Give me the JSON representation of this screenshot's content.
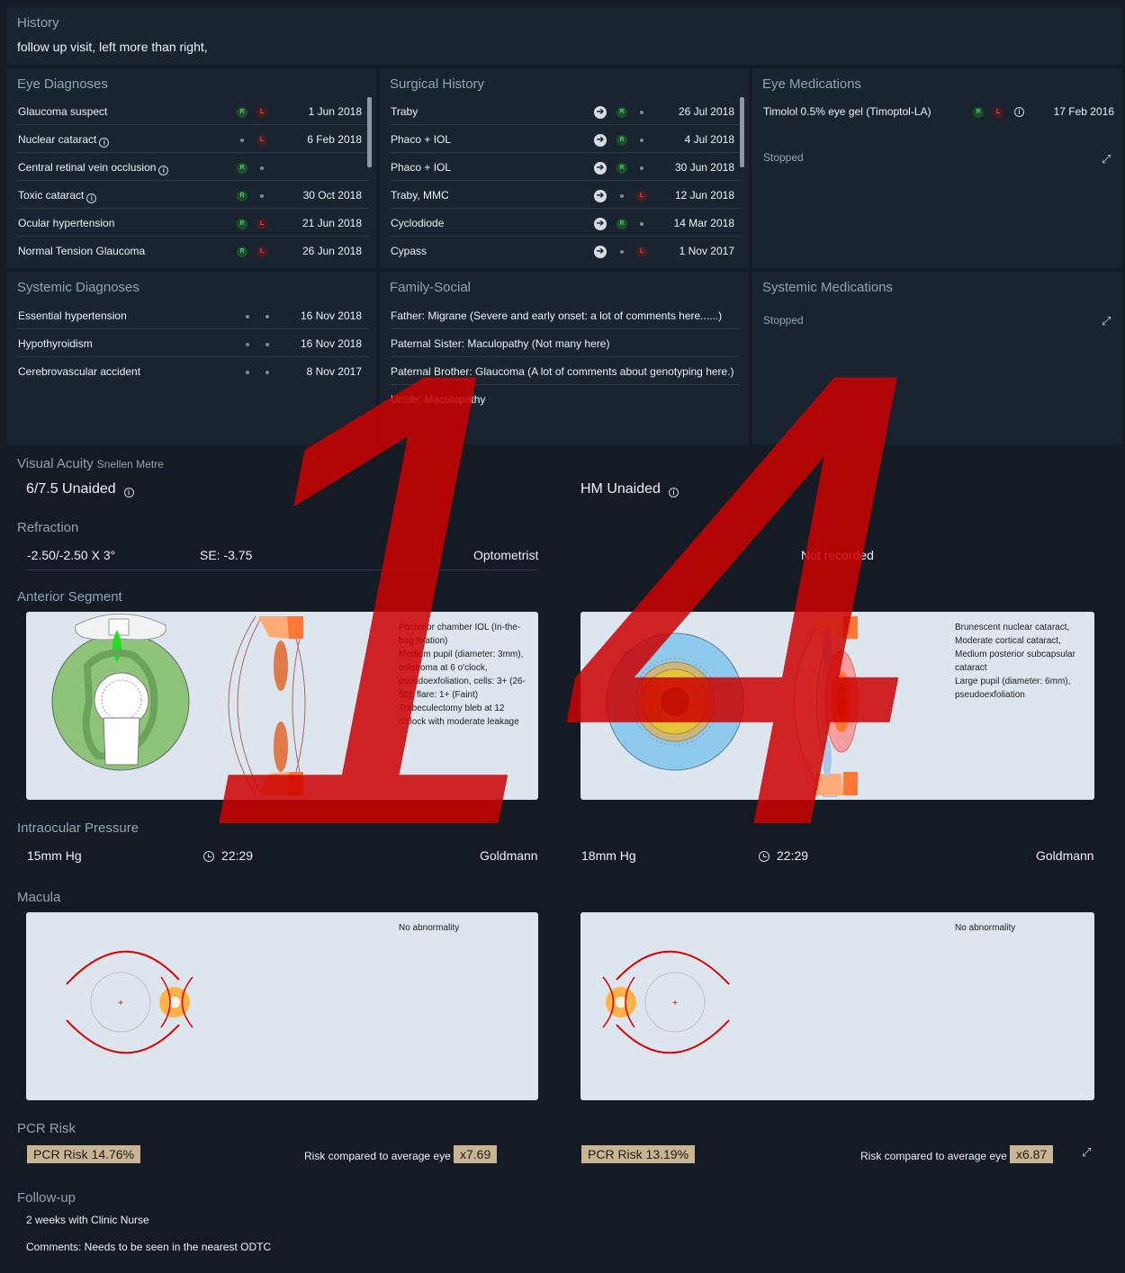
{
  "history": {
    "title": "History",
    "text": "follow up visit, left more than right,"
  },
  "eye_diagnoses": {
    "title": "Eye Diagnoses",
    "rows": [
      {
        "label": "Glaucoma suspect",
        "date": "1 Jun 2018"
      },
      {
        "label": "Nuclear cataract",
        "date": "6 Feb 2018"
      },
      {
        "label": "Central retinal vein occlusion",
        "date": ""
      },
      {
        "label": "Toxic cataract",
        "date": "30 Oct 2018"
      },
      {
        "label": "Ocular hypertension",
        "date": "21 Jun 2018"
      },
      {
        "label": "Normal Tension Glaucoma",
        "date": "26 Jun 2018"
      }
    ]
  },
  "surgical_history": {
    "title": "Surgical History",
    "rows": [
      {
        "label": "Traby",
        "date": "26 Jul 2018"
      },
      {
        "label": "Phaco + IOL",
        "date": "4 Jul 2018"
      },
      {
        "label": "Phaco + IOL",
        "date": "30 Jun 2018"
      },
      {
        "label": "Traby, MMC",
        "date": "12 Jun 2018"
      },
      {
        "label": "Cyclodiode",
        "date": "14 Mar 2018"
      },
      {
        "label": "Cypass",
        "date": "1 Nov 2017"
      }
    ]
  },
  "eye_medications": {
    "title": "Eye Medications",
    "rows": [
      {
        "label": "Timolol 0.5% eye gel (Timoptol-LA)",
        "date": "17 Feb 2016"
      }
    ],
    "stopped": "Stopped"
  },
  "systemic_diagnoses": {
    "title": "Systemic Diagnoses",
    "rows": [
      {
        "label": "Essential hypertension",
        "date": "16 Nov 2018"
      },
      {
        "label": "Hypothyroidism",
        "date": "16 Nov 2018"
      },
      {
        "label": "Cerebrovascular accident",
        "date": "8 Nov 2017"
      }
    ]
  },
  "family_social": {
    "title": "Family-Social",
    "rows": [
      "Father: Migrane (Severe and early onset: a lot of comments here......)",
      "Paternal Sister: Maculopathy (Not many here)",
      "Paternal Brother: Glaucoma (A lot of comments about genotyping here.)",
      "Uncle: Maculopathy"
    ]
  },
  "systemic_medications": {
    "title": "Systemic Medications",
    "stopped": "Stopped"
  },
  "badges": {
    "r": "R",
    "l": "L"
  },
  "icons": {
    "info": "info-icon",
    "arrow": "arrow-right-icon",
    "expand": "expand-icon",
    "clock": "clock-icon"
  },
  "visual_acuity": {
    "title": "Visual Acuity",
    "subtitle": "Snellen Metre",
    "right": "6/7.5 Unaided",
    "left": "HM Unaided"
  },
  "refraction": {
    "title": "Refraction",
    "right_value": "-2.50/-2.50 X 3°",
    "right_se": "SE: -3.75",
    "right_source": "Optometrist",
    "left": "Not recorded"
  },
  "anterior_segment": {
    "title": "Anterior Segment",
    "right_lines": [
      "Posterior chamber IOL (In-the-",
      "bag fixation)",
      "Medium pupil (diameter: 3mm),",
      "coloboma at 6 o'clock,",
      "pseudoexfoliation, cells: 3+ (26-",
      "50), flare: 1+ (Faint)",
      "Trabeculectomy bleb at 12",
      "o'clock with moderate leakage"
    ],
    "left_lines": [
      "Brunescent nuclear cataract,",
      "Moderate cortical cataract,",
      "Medium posterior subcapsular",
      "cataract",
      "Large pupil (diameter: 6mm),",
      "pseudoexfoliation"
    ]
  },
  "iop": {
    "title": "Intraocular Pressure",
    "right_value": "15mm Hg",
    "right_time": "22:29",
    "right_method": "Goldmann",
    "left_value": "18mm Hg",
    "left_time": "22:29",
    "left_method": "Goldmann"
  },
  "macula": {
    "title": "Macula",
    "right": "No abnormality",
    "left": "No abnormality"
  },
  "pcr_risk": {
    "title": "PCR Risk",
    "right_risk": "PCR Risk 14.76%",
    "right_compare": "Risk compared to average eye",
    "right_factor": "x7.69",
    "left_risk": "PCR Risk 13.19%",
    "left_compare": "Risk compared to average eye",
    "left_factor": "x6.87"
  },
  "follow_up": {
    "title": "Follow-up",
    "line1": "2 weeks with Clinic Nurse",
    "line2": "Comments: Needs to be seen in the nearest ODTC"
  },
  "watermark": {
    "text": "14",
    "color": "#cc0000"
  }
}
